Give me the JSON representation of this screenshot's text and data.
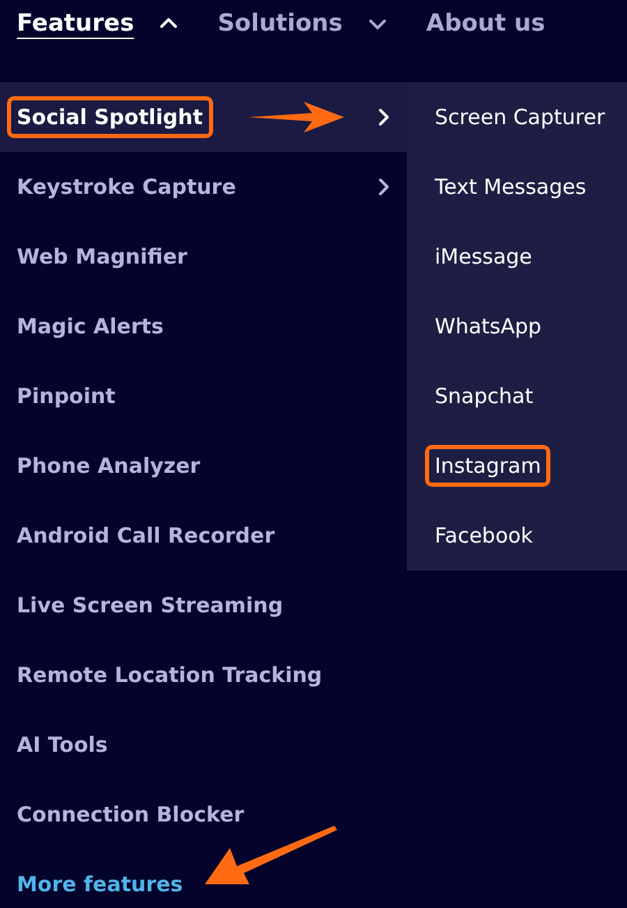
{
  "nav": [
    {
      "label": "Features",
      "expanded": true,
      "active": true,
      "dropdown": true
    },
    {
      "label": "Solutions",
      "expanded": false,
      "active": false,
      "dropdown": true
    },
    {
      "label": "About us",
      "active": false,
      "dropdown": false
    }
  ],
  "menu": [
    {
      "label": "Social Spotlight",
      "kind": "item",
      "submenu": true,
      "selected": true,
      "highlighted": true
    },
    {
      "label": "Keystroke Capture",
      "kind": "item",
      "submenu": true,
      "selected": false,
      "highlighted": false
    },
    {
      "label": "Web Magnifier",
      "kind": "item",
      "submenu": false,
      "selected": false,
      "highlighted": false
    },
    {
      "label": "Magic Alerts",
      "kind": "item",
      "submenu": false,
      "selected": false,
      "highlighted": false
    },
    {
      "label": "Pinpoint",
      "kind": "item",
      "submenu": false,
      "selected": false,
      "highlighted": false
    },
    {
      "label": "Phone Analyzer",
      "kind": "item",
      "submenu": false,
      "selected": false,
      "highlighted": false
    },
    {
      "label": "Android Call Recorder",
      "kind": "item",
      "submenu": false,
      "selected": false,
      "highlighted": false
    },
    {
      "label": "Live Screen Streaming",
      "kind": "item",
      "submenu": false,
      "selected": false,
      "highlighted": false
    },
    {
      "label": "Remote Location Tracking",
      "kind": "item",
      "submenu": false,
      "selected": false,
      "highlighted": false
    },
    {
      "label": "AI Tools",
      "kind": "item",
      "submenu": false,
      "selected": false,
      "highlighted": false
    },
    {
      "label": "Connection Blocker",
      "kind": "item",
      "submenu": false,
      "selected": false,
      "highlighted": false
    },
    {
      "label": "More features",
      "kind": "link",
      "submenu": false,
      "selected": false,
      "highlighted": false
    }
  ],
  "submenu": [
    {
      "label": "Screen Capturer",
      "highlighted": false
    },
    {
      "label": "Text Messages",
      "highlighted": false
    },
    {
      "label": "iMessage",
      "highlighted": false
    },
    {
      "label": "WhatsApp",
      "highlighted": false
    },
    {
      "label": "Snapchat",
      "highlighted": false
    },
    {
      "label": "Instagram",
      "highlighted": true
    },
    {
      "label": "Facebook",
      "highlighted": false
    }
  ]
}
